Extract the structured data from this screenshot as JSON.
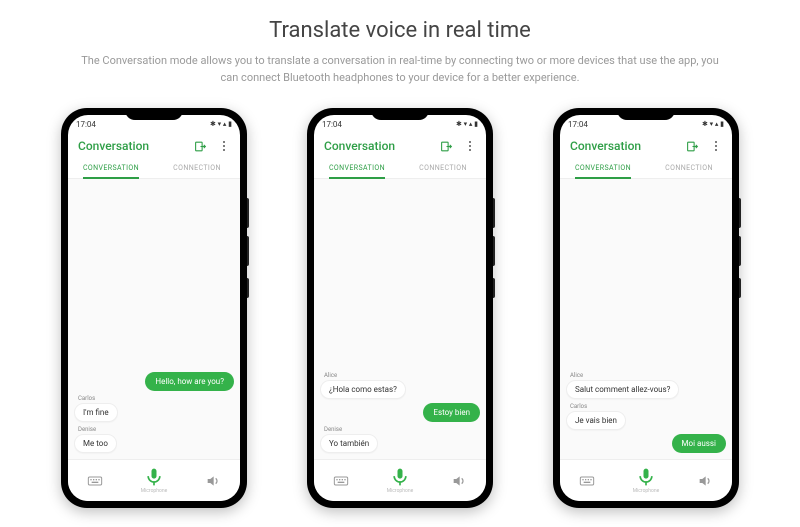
{
  "header": {
    "title": "Translate voice in real time",
    "subtitle": "The Conversation mode allows you to translate a conversation in real-time by connecting two or more devices that use the app, you can connect Bluetooth headphones to your device for a better experience."
  },
  "common": {
    "status_time": "17:04",
    "status_icons": "✱ ▾ ▴ ▮",
    "screen_title": "Conversation",
    "tab_conversation": "CONVERSATION",
    "tab_connection": "CONNECTION",
    "mic_label": "Microphone"
  },
  "phones": [
    {
      "outgoing": [
        {
          "text": "Hello, how are you?"
        }
      ],
      "incoming": [
        {
          "who": "Carlos",
          "text": "I'm fine"
        },
        {
          "who": "Denise",
          "text": "Me too"
        }
      ],
      "order": [
        "out-0",
        "in-0",
        "in-1"
      ]
    },
    {
      "outgoing": [
        {
          "text": "Estoy bien"
        }
      ],
      "incoming": [
        {
          "who": "Alice",
          "text": "¿Hola como estas?"
        },
        {
          "who": "Denise",
          "text": "Yo también"
        }
      ],
      "order": [
        "in-0",
        "out-0",
        "in-1"
      ]
    },
    {
      "outgoing": [
        {
          "text": "Moi aussi"
        }
      ],
      "incoming": [
        {
          "who": "Alice",
          "text": "Salut comment allez-vous?"
        },
        {
          "who": "Carlos",
          "text": "Je vais bien"
        }
      ],
      "order": [
        "in-0",
        "in-1",
        "out-0"
      ]
    }
  ]
}
